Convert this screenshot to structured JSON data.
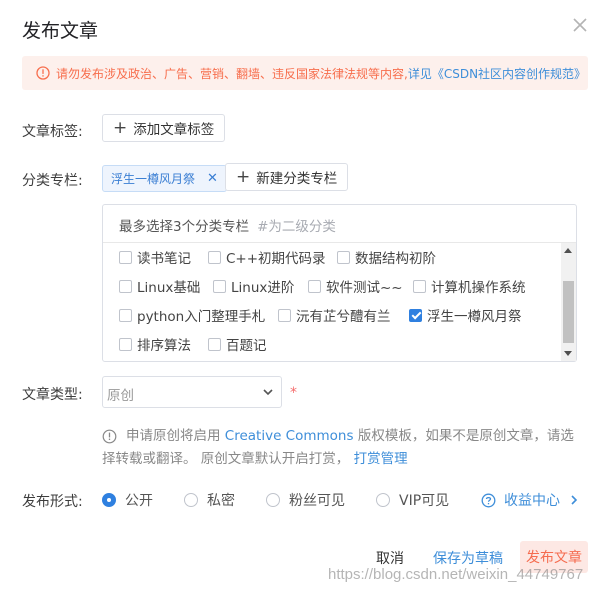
{
  "dialog": {
    "title": "发布文章",
    "close_icon": "close-icon"
  },
  "alert": {
    "text": "请勿发布涉及政治、广告、营销、翻墙、违反国家法律法规等内容,",
    "link": "详见《CSDN社区内容创作规范》",
    "color": "#f76e4d",
    "bg": "#fdf0ec"
  },
  "tags": {
    "label": "文章标签:",
    "add_button": "添加文章标签"
  },
  "column": {
    "label": "分类专栏:",
    "selected_tag": "浮生一樽风月祭",
    "new_button": "新建分类专栏",
    "panel_hint": "最多选择3个分类专栏",
    "panel_hint_sub": "#为二级分类",
    "rows": [
      [
        {
          "label": "读书笔记",
          "checked": false
        },
        {
          "label": "C++初期代码录",
          "checked": false
        },
        {
          "label": "数据结构初阶",
          "checked": false
        }
      ],
      [
        {
          "label": "Linux基础",
          "checked": false
        },
        {
          "label": "Linux进阶",
          "checked": false
        },
        {
          "label": "软件测试~~",
          "checked": false
        },
        {
          "label": "计算机操作系统",
          "checked": false
        }
      ],
      [
        {
          "label": "python入门整理手札",
          "checked": false
        },
        {
          "label": "沅有芷兮醴有兰",
          "checked": false
        },
        {
          "label": "浮生一樽风月祭",
          "checked": true
        }
      ],
      [
        {
          "label": "排序算法",
          "checked": false
        },
        {
          "label": "百题记",
          "checked": false
        }
      ]
    ]
  },
  "article_type": {
    "label": "文章类型:",
    "value": "原创",
    "required_mark": "*",
    "note_part1": "申请原创将启用",
    "note_cc": "Creative Commons",
    "note_part2": "版权模板，如果不是原创文章，请选",
    "note_line2": "择转载或翻译。 原创文章默认开启打赏，",
    "note_manage": "打赏管理"
  },
  "publish_form": {
    "label": "发布形式:",
    "options": [
      "公开",
      "私密",
      "粉丝可见",
      "VIP可见"
    ],
    "selected": "公开",
    "revenue_link": "收益中心"
  },
  "footer": {
    "cancel": "取消",
    "save_draft": "保存为草稿",
    "publish": "发布文章"
  },
  "watermark": "https://blog.csdn.net/weixin_44749767",
  "colors": {
    "accent": "#2f80e0",
    "link": "#3e8ed9",
    "danger": "#f56c6c"
  }
}
